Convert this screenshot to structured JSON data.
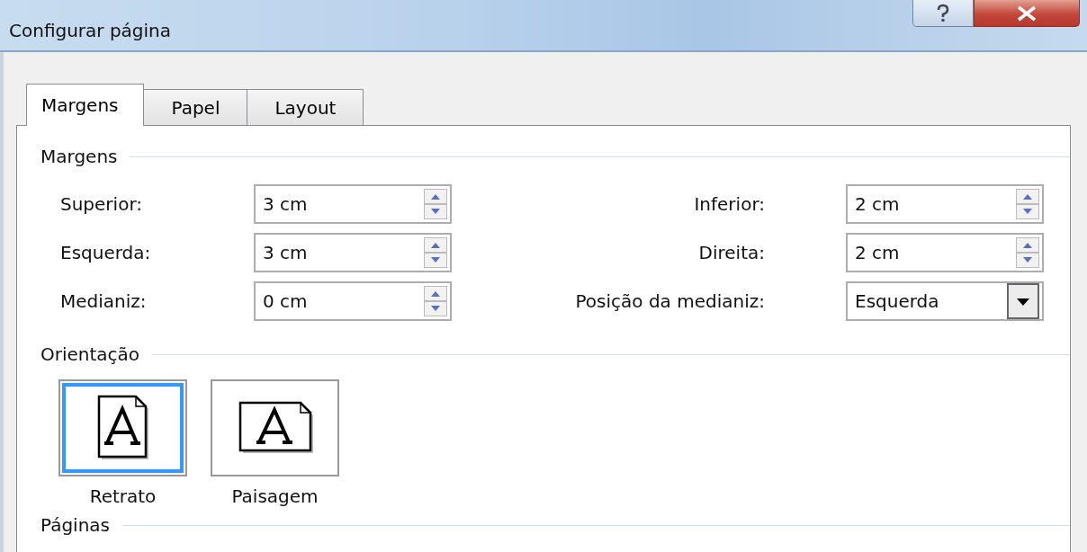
{
  "window": {
    "title": "Configurar página"
  },
  "tabs": [
    {
      "label": "Margens",
      "selected": true
    },
    {
      "label": "Papel",
      "selected": false
    },
    {
      "label": "Layout",
      "selected": false
    }
  ],
  "margins": {
    "title": "Margens",
    "left": [
      {
        "label": "Superior:",
        "value": "3 cm",
        "kind": "spin"
      },
      {
        "label": "Esquerda:",
        "value": "3 cm",
        "kind": "spin"
      },
      {
        "label": "Medianiz:",
        "value": "0 cm",
        "kind": "spin"
      }
    ],
    "right": [
      {
        "label": "Inferior:",
        "value": "2 cm",
        "kind": "spin"
      },
      {
        "label": "Direita:",
        "value": "2 cm",
        "kind": "spin"
      },
      {
        "label": "Posição da medianiz:",
        "value": "Esquerda",
        "kind": "dropdown"
      }
    ]
  },
  "orientation": {
    "title": "Orientação",
    "options": [
      {
        "label": "Retrato",
        "kind": "portrait",
        "selected": true
      },
      {
        "label": "Paisagem",
        "kind": "landscape",
        "selected": false
      }
    ]
  },
  "pages": {
    "title": "Páginas"
  }
}
